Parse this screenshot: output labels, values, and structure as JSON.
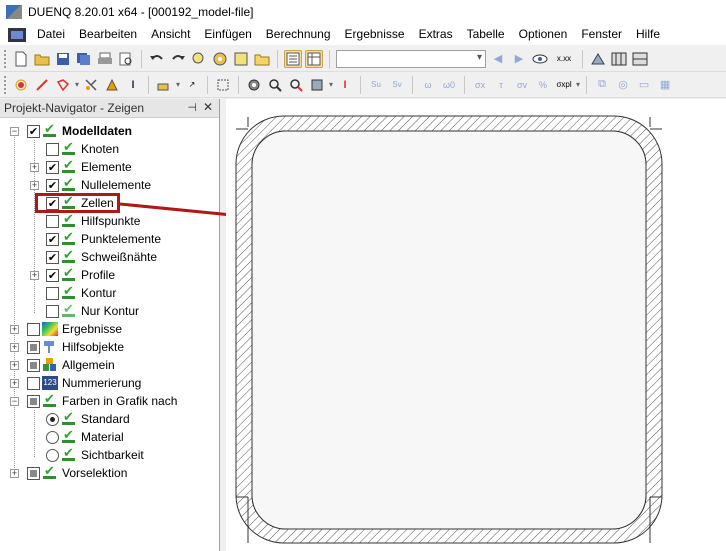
{
  "titlebar": {
    "title": "DUENQ 8.20.01 x64 - [000192_model-file]"
  },
  "menu": [
    "Datei",
    "Bearbeiten",
    "Ansicht",
    "Einfügen",
    "Berechnung",
    "Ergebnisse",
    "Extras",
    "Tabelle",
    "Optionen",
    "Fenster",
    "Hilfe"
  ],
  "toolbar": {
    "combo_value": "",
    "xxx_label": "x.xx"
  },
  "navigator": {
    "title": "Projekt-Navigator - Zeigen",
    "pin": "⊣",
    "close": "✕",
    "items": [
      {
        "label": "Modelldaten",
        "checked": "✔"
      },
      {
        "label": "Knoten",
        "checked": ""
      },
      {
        "label": "Elemente",
        "checked": "✔"
      },
      {
        "label": "Nullelemente",
        "checked": "✔"
      },
      {
        "label": "Zellen",
        "checked": "✔"
      },
      {
        "label": "Hilfspunkte",
        "checked": ""
      },
      {
        "label": "Punktelemente",
        "checked": "✔"
      },
      {
        "label": "Schweißnähte",
        "checked": "✔"
      },
      {
        "label": "Profile",
        "checked": "✔"
      },
      {
        "label": "Kontur",
        "checked": ""
      },
      {
        "label": "Nur Kontur",
        "checked": ""
      },
      {
        "label": "Ergebnisse",
        "checked": ""
      },
      {
        "label": "Hilfsobjekte",
        "checked": ""
      },
      {
        "label": "Allgemein",
        "checked": ""
      },
      {
        "label": "Nummerierung",
        "checked": ""
      },
      {
        "label": "Farben in Grafik nach",
        "checked": ""
      },
      {
        "label": "Standard"
      },
      {
        "label": "Material"
      },
      {
        "label": "Sichtbarkeit"
      },
      {
        "label": "Vorselektion",
        "checked": ""
      }
    ],
    "icon_numbering": "123"
  },
  "colors": {
    "highlight": "#b01818",
    "hatch": "#555555",
    "check_green": "#2fa52f"
  }
}
